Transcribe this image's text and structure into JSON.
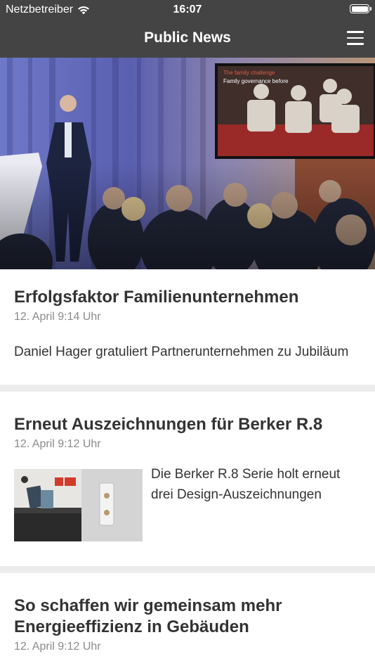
{
  "status_bar": {
    "carrier": "Netzbetreiber",
    "time": "16:07"
  },
  "nav": {
    "title": "Public News",
    "menu_icon": "hamburger-menu-icon"
  },
  "hero_image": {
    "screen_caption_line1": "The family challenge",
    "screen_caption_line2": "Family governance before"
  },
  "articles": [
    {
      "title": "Erfolgsfaktor Familienunternehmen",
      "date": "12. April 9:14 Uhr",
      "teaser": "Daniel Hager gratuliert Partnerunternehmen zu Jubiläum"
    },
    {
      "title": "Erneut Auszeichnungen für Berker R.8",
      "date": "12. April 9:12 Uhr",
      "teaser": "Die Berker R.8 Serie holt erneut drei Design-Auszeichnungen"
    },
    {
      "title_line1": "So schaffen wir gemeinsam mehr",
      "title_line2": "Energieeffizienz in Gebäuden",
      "date": "12. April 9:12 Uhr"
    }
  ],
  "colors": {
    "bar": "#444444",
    "text": "#333333",
    "date": "#8a8a8a",
    "divider": "#ececec"
  }
}
